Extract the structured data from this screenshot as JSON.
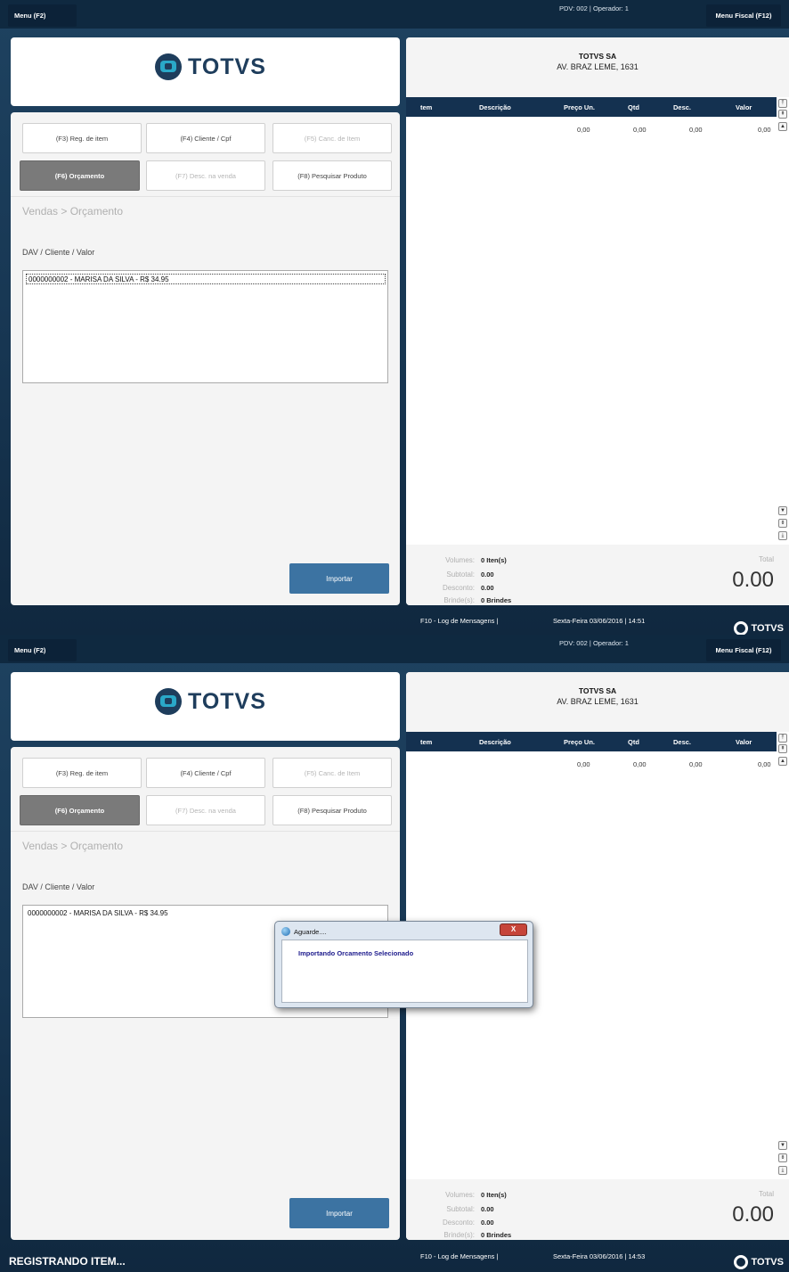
{
  "colors": {
    "background": "#17344f",
    "accent": "#3c73a2",
    "grid_header": "#143150",
    "dialog_text": "#1c1a8c"
  },
  "brand": {
    "logo_text": "TOTVS",
    "footer_logo_text": "TOTVS"
  },
  "topbar": {
    "menu_label": "Menu (F2)",
    "pdv_info": "PDV: 002   |   Operador: 1",
    "fiscal_label": "Menu Fiscal (F12)"
  },
  "buttons": {
    "f3": "(F3) Reg. de item",
    "f4": "(F4) Cliente / Cpf",
    "f5": "(F5) Canc. de Item",
    "f6": "(F6) Orçamento",
    "f7": "(F7) Desc. na venda",
    "f8": "(F8) Pesquisar Produto"
  },
  "breadcrumb": "Vendas > Orçamento",
  "section_label": "DAV  /  Cliente  /  Valor",
  "list_items": [
    "0000000002 - MARISA DA SILVA - R$ 34.95"
  ],
  "import_label": "Importar",
  "company": {
    "name": "TOTVS SA",
    "address": "AV. BRAZ LEME, 1631"
  },
  "grid": {
    "columns": [
      "tem",
      "Descrição",
      "Preço Un.",
      "Qtd",
      "Desc.",
      "Valor"
    ],
    "row": {
      "preco": "0,00",
      "qtd": "0,00",
      "desc": "0,00",
      "valor": "0,00"
    }
  },
  "totals": {
    "volumes_label": "Volumes:",
    "volumes_value": "0 Iten(s)",
    "subtotal_label": "Subtotal:",
    "subtotal_value": "0.00",
    "desconto_label": "Desconto:",
    "desconto_value": "0.00",
    "brindes_label": "Brinde(s):",
    "brindes_value": "0 Brindes",
    "total_label": "Total",
    "total_value": "0.00"
  },
  "status": {
    "log": "F10 - Log de Mensagens |",
    "date1": "Sexta-Feira 03/06/2016 | 14:51",
    "date2": "Sexta-Feira 03/06/2016 | 14:53",
    "registrando": "REGISTRANDO ITEM..."
  },
  "dialog": {
    "title": "Aguarde....",
    "close": "X",
    "message": "Importando Orcamento Selecionado"
  }
}
